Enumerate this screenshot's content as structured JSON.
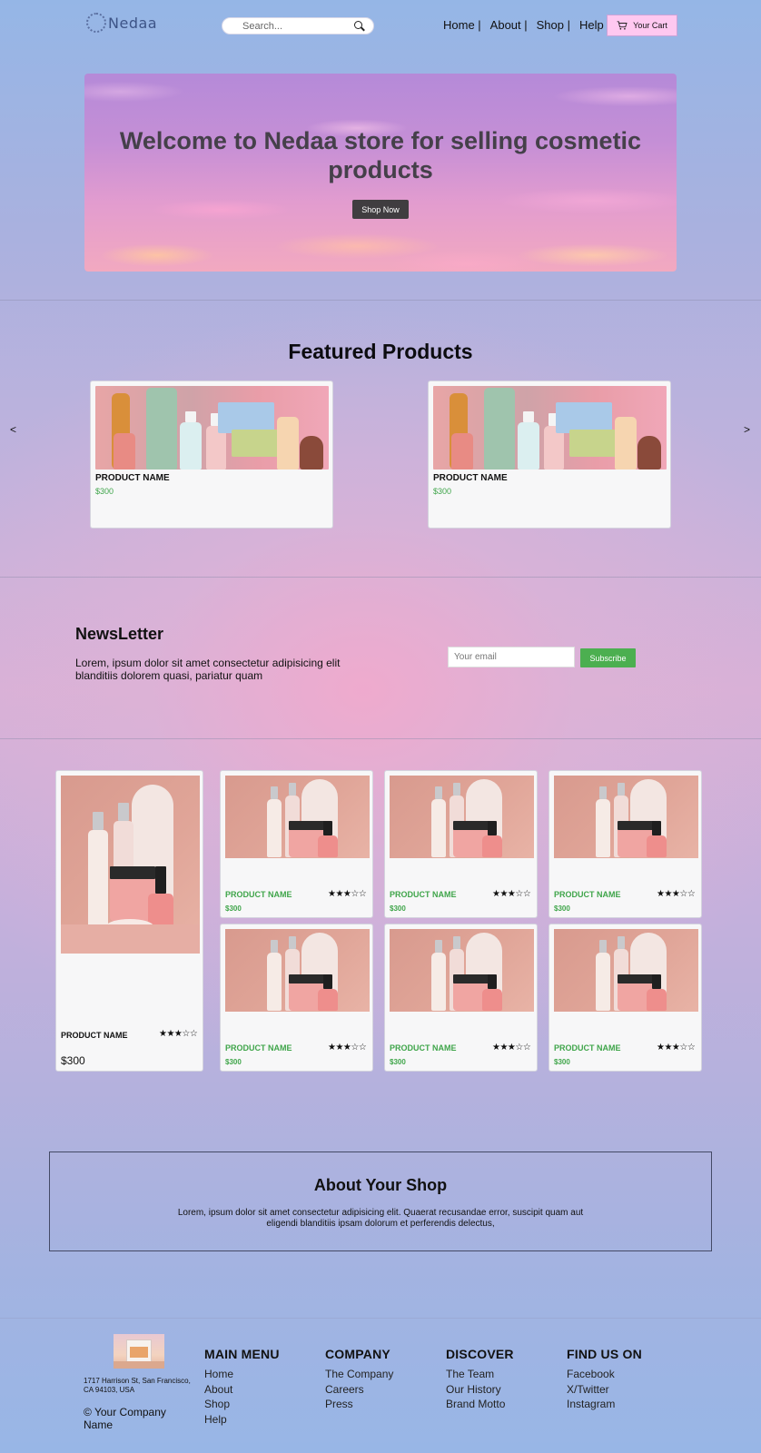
{
  "header": {
    "logo_text": "Nedaa",
    "search_placeholder": "Search...",
    "nav": [
      "Home |",
      "About |",
      "Shop |",
      "Help"
    ],
    "cart_label": "Your Cart"
  },
  "hero": {
    "title": "Welcome to Nedaa store for selling cosmetic products",
    "button": "Shop Now"
  },
  "featured": {
    "title": "Featured Products",
    "prev": "<",
    "next": ">",
    "cards": [
      {
        "name": "PRODUCT NAME",
        "price": "$300"
      },
      {
        "name": "PRODUCT NAME",
        "price": "$300"
      }
    ]
  },
  "newsletter": {
    "title": "NewsLetter",
    "text": "Lorem, ipsum dolor sit amet consectetur adipisicing elit blanditiis dolorem quasi, pariatur quam",
    "input_placeholder": "Your email",
    "button": "Subscribe"
  },
  "products": {
    "large": {
      "name": "PRODUCT NAME",
      "rating": "★★★☆☆",
      "price": "$300"
    },
    "items": [
      {
        "name": "PRODUCT NAME",
        "rating": "★★★☆☆",
        "price": "$300"
      },
      {
        "name": "PRODUCT NAME",
        "rating": "★★★☆☆",
        "price": "$300"
      },
      {
        "name": "PRODUCT NAME",
        "rating": "★★★☆☆",
        "price": "$300"
      },
      {
        "name": "PRODUCT NAME",
        "rating": "★★★☆☆",
        "price": "$300"
      },
      {
        "name": "PRODUCT NAME",
        "rating": "★★★☆☆",
        "price": "$300"
      },
      {
        "name": "PRODUCT NAME",
        "rating": "★★★☆☆",
        "price": "$300"
      }
    ]
  },
  "about": {
    "title": "About Your Shop",
    "text": "Lorem, ipsum dolor sit amet consectetur adipisicing elit. Quaerat recusandae error, suscipit quam aut eligendi blanditiis ipsam dolorum et perferendis delectus,"
  },
  "footer": {
    "address": "1717 Harrison St, San Francisco, CA 94103, USA",
    "copyright": "© Your Company Name",
    "columns": [
      {
        "title": "MAIN MENU",
        "links": [
          "Home",
          "About",
          "Shop",
          "Help"
        ]
      },
      {
        "title": "COMPANY",
        "links": [
          "The Company",
          "Careers",
          "Press"
        ]
      },
      {
        "title": "DISCOVER",
        "links": [
          "The Team",
          "Our History",
          "Brand Motto"
        ]
      },
      {
        "title": "FIND US ON",
        "links": [
          "Facebook",
          "X/Twitter",
          "Instagram"
        ]
      }
    ]
  },
  "colors": {
    "accent_green": "#4caf50",
    "cart_pink": "#ffc8f0",
    "button_dark": "#403d40"
  }
}
